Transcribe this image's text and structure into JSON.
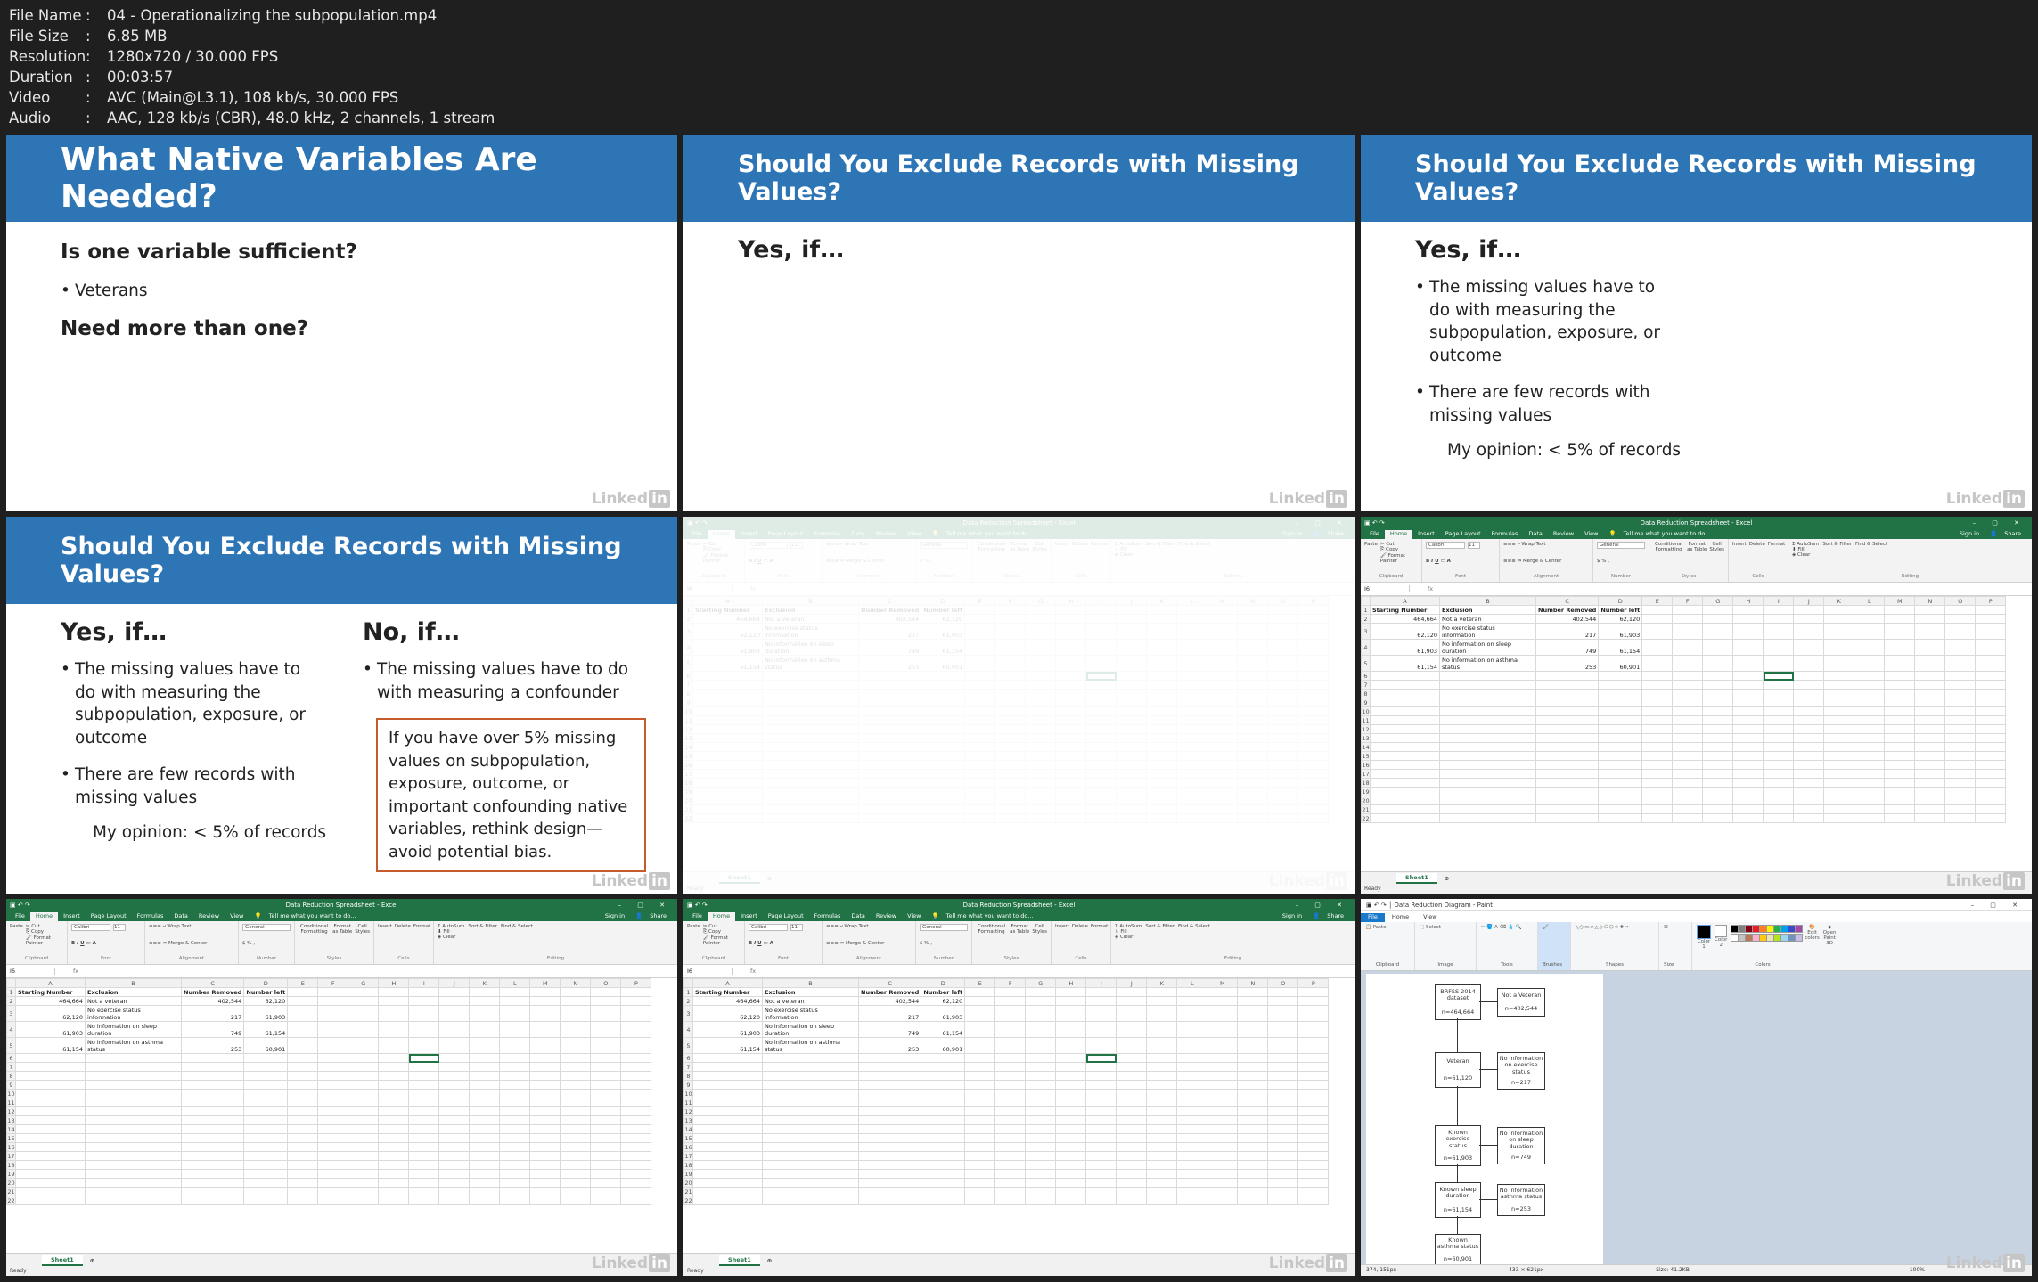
{
  "file_info": [
    {
      "k": "File Name",
      "v": "04 - Operationalizing the subpopulation.mp4"
    },
    {
      "k": "File Size",
      "v": "6.85 MB"
    },
    {
      "k": "Resolution",
      "v": "1280x720 / 30.000 FPS"
    },
    {
      "k": "Duration",
      "v": "00:03:57"
    },
    {
      "k": "Video",
      "v": "AVC (Main@L3.1), 108 kb/s, 30.000 FPS"
    },
    {
      "k": "Audio",
      "v": "AAC, 128 kb/s (CBR), 48.0 kHz, 2 channels, 1 stream"
    }
  ],
  "watermark": {
    "linked": "Linked",
    "in": "in"
  },
  "slide1": {
    "title": "What Native Variables Are Needed?",
    "q1": "Is one variable sufficient?",
    "bullet1": "Veterans",
    "q2": "Need more than one?"
  },
  "slide2": {
    "title": "Should You Exclude Records with Missing Values?",
    "yes": "Yes, if…"
  },
  "slide3": {
    "title": "Should You Exclude Records with Missing Values?",
    "yes": "Yes, if…",
    "b1": "The missing values have to do with measuring the subpopulation, exposure, or outcome",
    "b2": "There are few records with missing values",
    "opinion": "My opinion: < 5% of records"
  },
  "slide4": {
    "title": "Should You Exclude Records with Missing Values?",
    "yes": "Yes, if…",
    "b1": "The missing values have to do with measuring the subpopulation, exposure, or outcome",
    "b2": "There are few records with missing values",
    "opinion": "My opinion: < 5% of records",
    "no": "No, if…",
    "nb1": "The missing values have to do with measuring a confounder",
    "box": "If you have over 5% missing values on subpopulation, exposure, outcome, or important confounding native variables, rethink design—avoid potential bias."
  },
  "excel": {
    "title": "Data Reduction Spreadsheet - Excel",
    "menu": [
      "File",
      "Home",
      "Insert",
      "Page Layout",
      "Formulas",
      "Data",
      "Review",
      "View"
    ],
    "tell_me": "Tell me what you want to do...",
    "signin": "Sign in",
    "share": "Share",
    "ribbon": {
      "clipboard": "Clipboard",
      "cut": "Cut",
      "copy": "Copy",
      "format_painter": "Format Painter",
      "paste": "Paste",
      "font": "Font",
      "font_name": "Calibri",
      "font_size": "11",
      "alignment": "Alignment",
      "wrap": "Wrap Text",
      "merge": "Merge & Center",
      "number": "Number",
      "general": "General",
      "styles": "Styles",
      "cond": "Conditional Formatting",
      "fmt_table": "Format as Table",
      "cell_styles": "Cell Styles",
      "cells": "Cells",
      "insert": "Insert",
      "delete": "Delete",
      "format": "Format",
      "editing": "Editing",
      "autosum": "AutoSum",
      "fill": "Fill",
      "clear": "Clear",
      "sort": "Sort & Filter",
      "find": "Find & Select"
    },
    "namebox": "I6",
    "fx": "fx",
    "columns": [
      "A",
      "B",
      "C",
      "D",
      "E",
      "F",
      "G",
      "H",
      "I",
      "J",
      "K",
      "L",
      "M",
      "N",
      "O",
      "P"
    ],
    "headers": [
      "Starting Number",
      "Exclusion",
      "Number Removed",
      "Number left"
    ],
    "rows": [
      {
        "a": "464,664",
        "b": "Not a veteran",
        "c": "402,544",
        "d": "62,120",
        "b0": ""
      },
      {
        "a": "62,120",
        "b0": "No exercise status",
        "b": "information",
        "c": "217",
        "d": "61,903"
      },
      {
        "a": "61,903",
        "b0": "No information on sleep",
        "b": "duration",
        "c": "749",
        "d": "61,154"
      },
      {
        "a": "61,154",
        "b0": "No information on asthma",
        "b": "status",
        "c": "253",
        "d": "60,901"
      }
    ],
    "sheet": "Sheet1",
    "status": "Ready"
  },
  "paint": {
    "title": "Data Reduction Diagram - Paint",
    "menu": [
      "File",
      "Home",
      "View"
    ],
    "groups": [
      "Clipboard",
      "Image",
      "Tools",
      "Shapes",
      "Size",
      "Colors"
    ],
    "btn_paste": "Paste",
    "btn_select": "Select",
    "btn_brushes": "Brushes",
    "btn_size": "Size",
    "btn_color1": "Color 1",
    "btn_color2": "Color 2",
    "btn_edit": "Edit colors",
    "btn_open3d": "Open Paint 3D",
    "status_pos": "374, 151px",
    "status_sel": "433 × 621px",
    "status_size": "Size: 41.2KB",
    "zoom": "100%",
    "flow": {
      "n1": [
        "BRFSS 2014",
        "dataset",
        "n=464,664"
      ],
      "e1": [
        "Not a Veteran",
        "n=402,544"
      ],
      "n2": [
        "Veteran",
        "n=61,120"
      ],
      "e2": [
        "No information",
        "on exercise",
        "status",
        "n=217"
      ],
      "n3": [
        "Known",
        "exercise",
        "status",
        "n=61,903"
      ],
      "e3": [
        "No information",
        "on sleep",
        "duration",
        "n=749"
      ],
      "n4": [
        "Known sleep",
        "duration",
        "n=61,154"
      ],
      "e4": [
        "No information",
        "asthma status",
        "n=253"
      ],
      "n5": [
        "Known",
        "asthma status",
        "n=60,901"
      ]
    },
    "palette": [
      "#000000",
      "#7f7f7f",
      "#880015",
      "#ed1c24",
      "#ff7f27",
      "#fff200",
      "#22b14c",
      "#00a2e8",
      "#3f48cc",
      "#a349a4",
      "#ffffff",
      "#c3c3c3",
      "#b97a57",
      "#ffaec9",
      "#ffc90e",
      "#efe4b0",
      "#b5e61d",
      "#99d9ea",
      "#7092be",
      "#c8bfe7"
    ]
  }
}
